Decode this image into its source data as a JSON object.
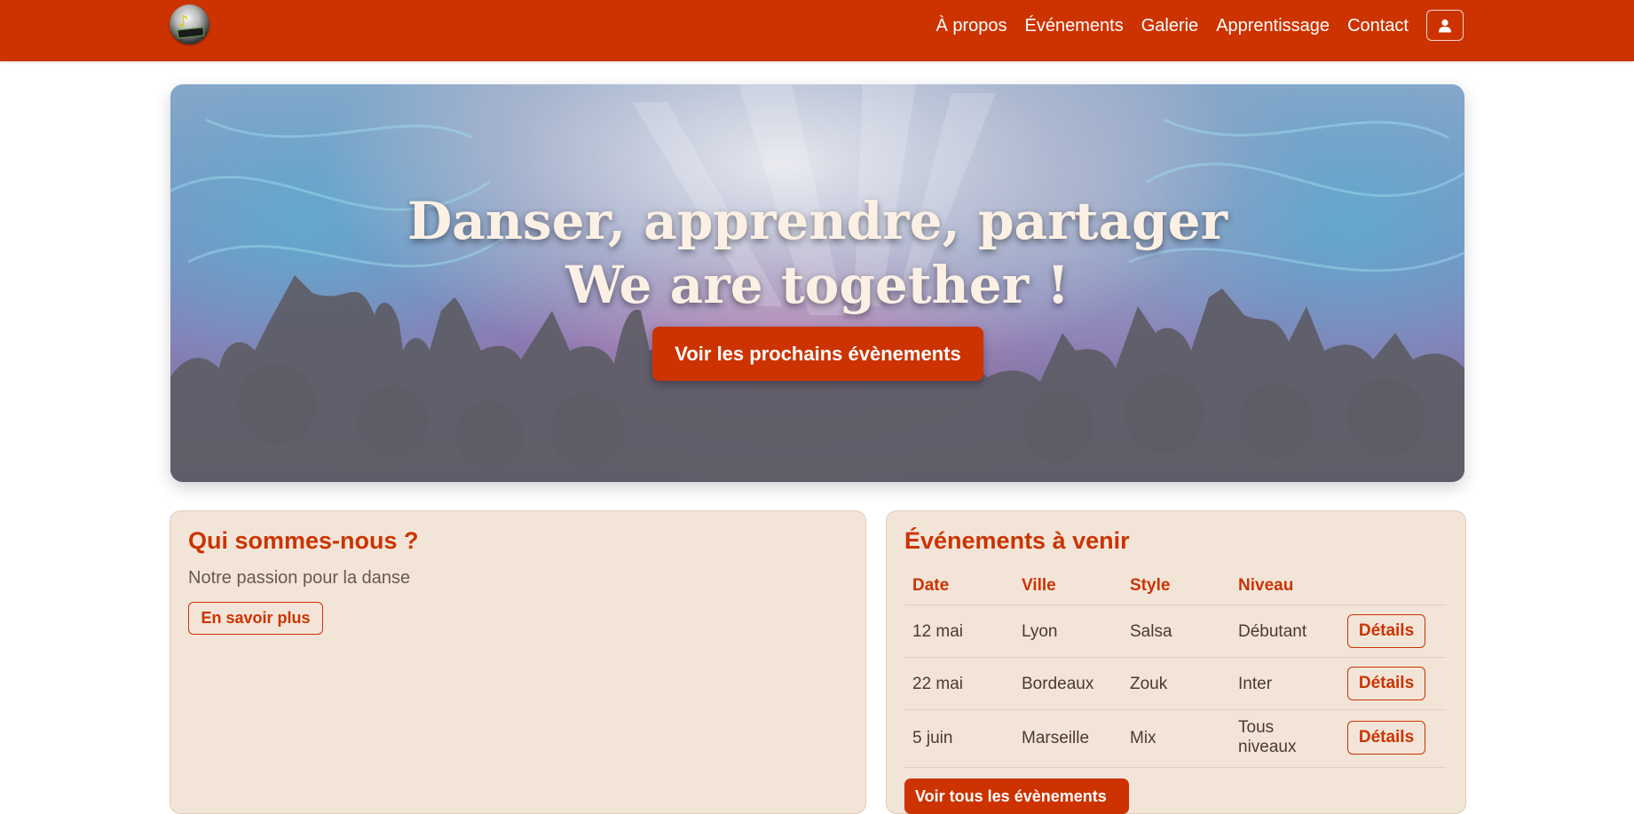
{
  "nav": {
    "links": [
      "À propos",
      "Événements",
      "Galerie",
      "Apprentissage",
      "Contact"
    ],
    "user_icon": "user-icon",
    "logo_icon": "logo"
  },
  "hero": {
    "title_line1": "Danser, apprendre, partager",
    "title_line2": "We are together !",
    "cta_label": "Voir les prochains évènements"
  },
  "about": {
    "title": "Qui sommes-nous ?",
    "subtitle": "Notre passion pour la danse",
    "button_label": "En savoir plus"
  },
  "events": {
    "title": "Événements à venir",
    "columns": [
      "Date",
      "Ville",
      "Style",
      "Niveau"
    ],
    "rows": [
      {
        "date": "12 mai",
        "city": "Lyon",
        "style": "Salsa",
        "level": "Débutant",
        "action": "Détails"
      },
      {
        "date": "22 mai",
        "city": "Bordeaux",
        "style": "Zouk",
        "level": "Inter",
        "action": "Détails"
      },
      {
        "date": "5 juin",
        "city": "Marseille",
        "style": "Mix",
        "level": "Tous niveaux",
        "action": "Détails"
      }
    ],
    "all_button_label": "Voir tous les évènements"
  },
  "colors": {
    "primary": "#cc3300",
    "card_bg": "#f2e5d8",
    "hero_text": "#fbf0e3"
  }
}
